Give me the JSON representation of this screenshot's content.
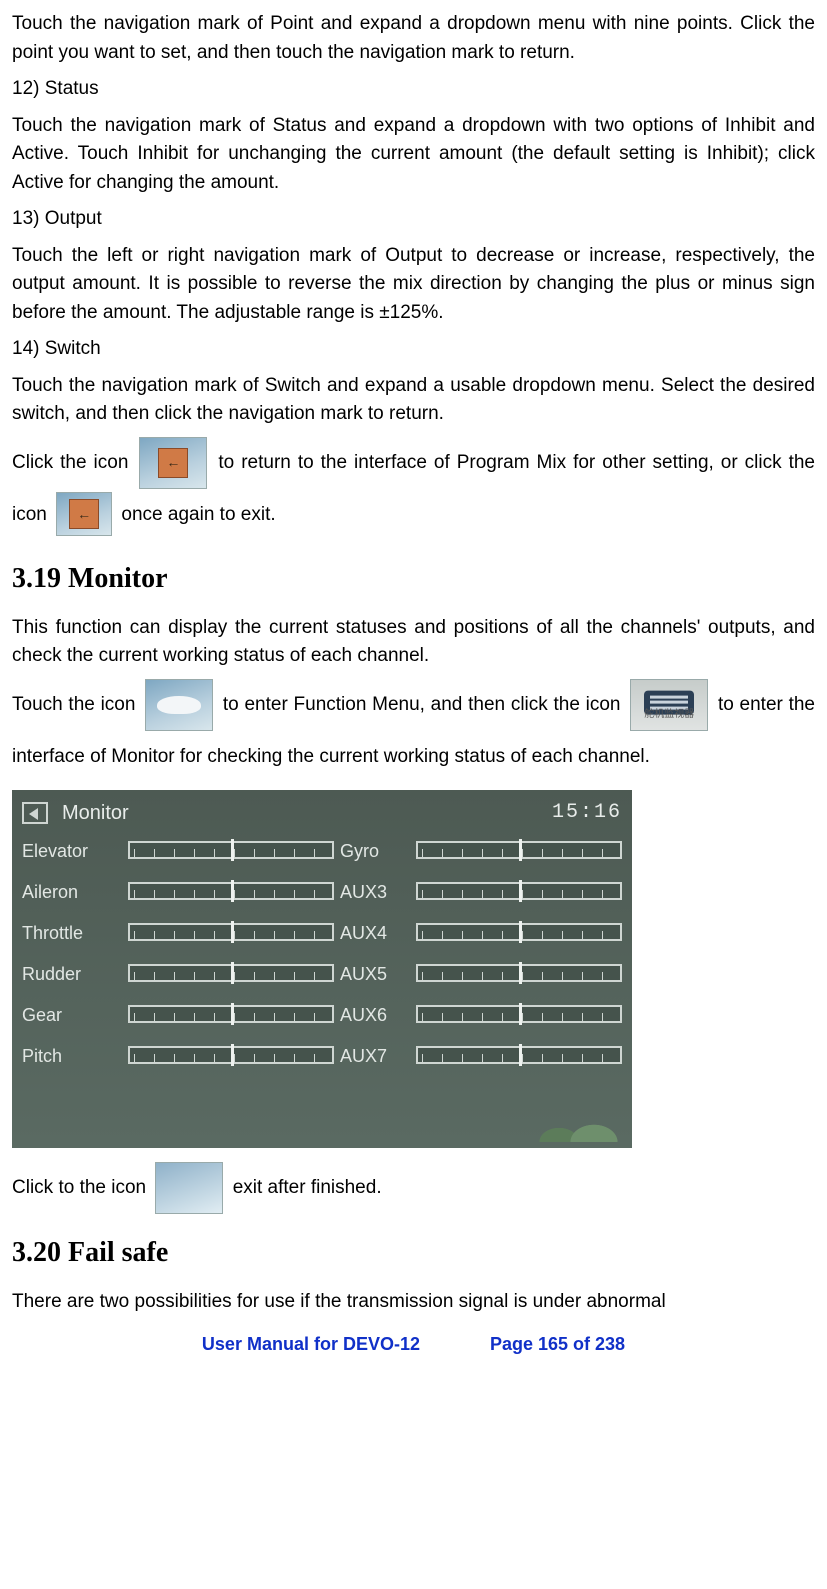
{
  "p1": "Touch the navigation mark of Point and expand a dropdown menu with nine points. Click the point you want to set, and then touch the navigation mark to return.",
  "p2": "12) Status",
  "p3": "Touch the navigation mark of Status and expand a dropdown with two options of Inhibit and Active. Touch Inhibit for unchanging the current amount (the default setting is Inhibit); click Active for changing the amount.",
  "p4": "13) Output",
  "p5": "Touch the left or right navigation mark of Output to decrease or increase, respectively, the output amount. It is possible to reverse the mix direction by changing the plus or minus sign before the amount. The adjustable range is ±125%.",
  "p6": "14) Switch",
  "p7": "Touch the navigation mark of Switch and expand a usable dropdown menu. Select the desired switch, and then click the navigation mark to return.",
  "p8a": "Click the icon ",
  "p8b": " to return to the interface of Program Mix for other setting, or click the icon ",
  "p8c": " once again to exit.",
  "h1": "3.19 Monitor",
  "p9": "This function can display the current statuses and positions of all the channels' outputs, and check the current working status of each channel.",
  "p10a": "Touch the icon ",
  "p10b": " to enter Function Menu, and then click the icon ",
  "p10c": " to enter the interface of Monitor for checking the current working status of each channel.",
  "screenshot": {
    "title": "Monitor",
    "clock": "15:16",
    "rows": [
      [
        "Elevator",
        "Gyro"
      ],
      [
        "Aileron",
        "AUX3"
      ],
      [
        "Throttle",
        "AUX4"
      ],
      [
        "Rudder",
        "AUX5"
      ],
      [
        "Gear",
        "AUX6"
      ],
      [
        "Pitch",
        "AUX7"
      ]
    ]
  },
  "p11a": "Click to the icon ",
  "p11b": " exit after finished.",
  "h2": "3.20 Fail safe",
  "p12": "There are two possibilities for use if the transmission signal is under abnormal",
  "footer": {
    "left": "User Manual for DEVO-12",
    "right": "Page 165 of 238"
  },
  "monitorIconCaption": "舵机监视器"
}
